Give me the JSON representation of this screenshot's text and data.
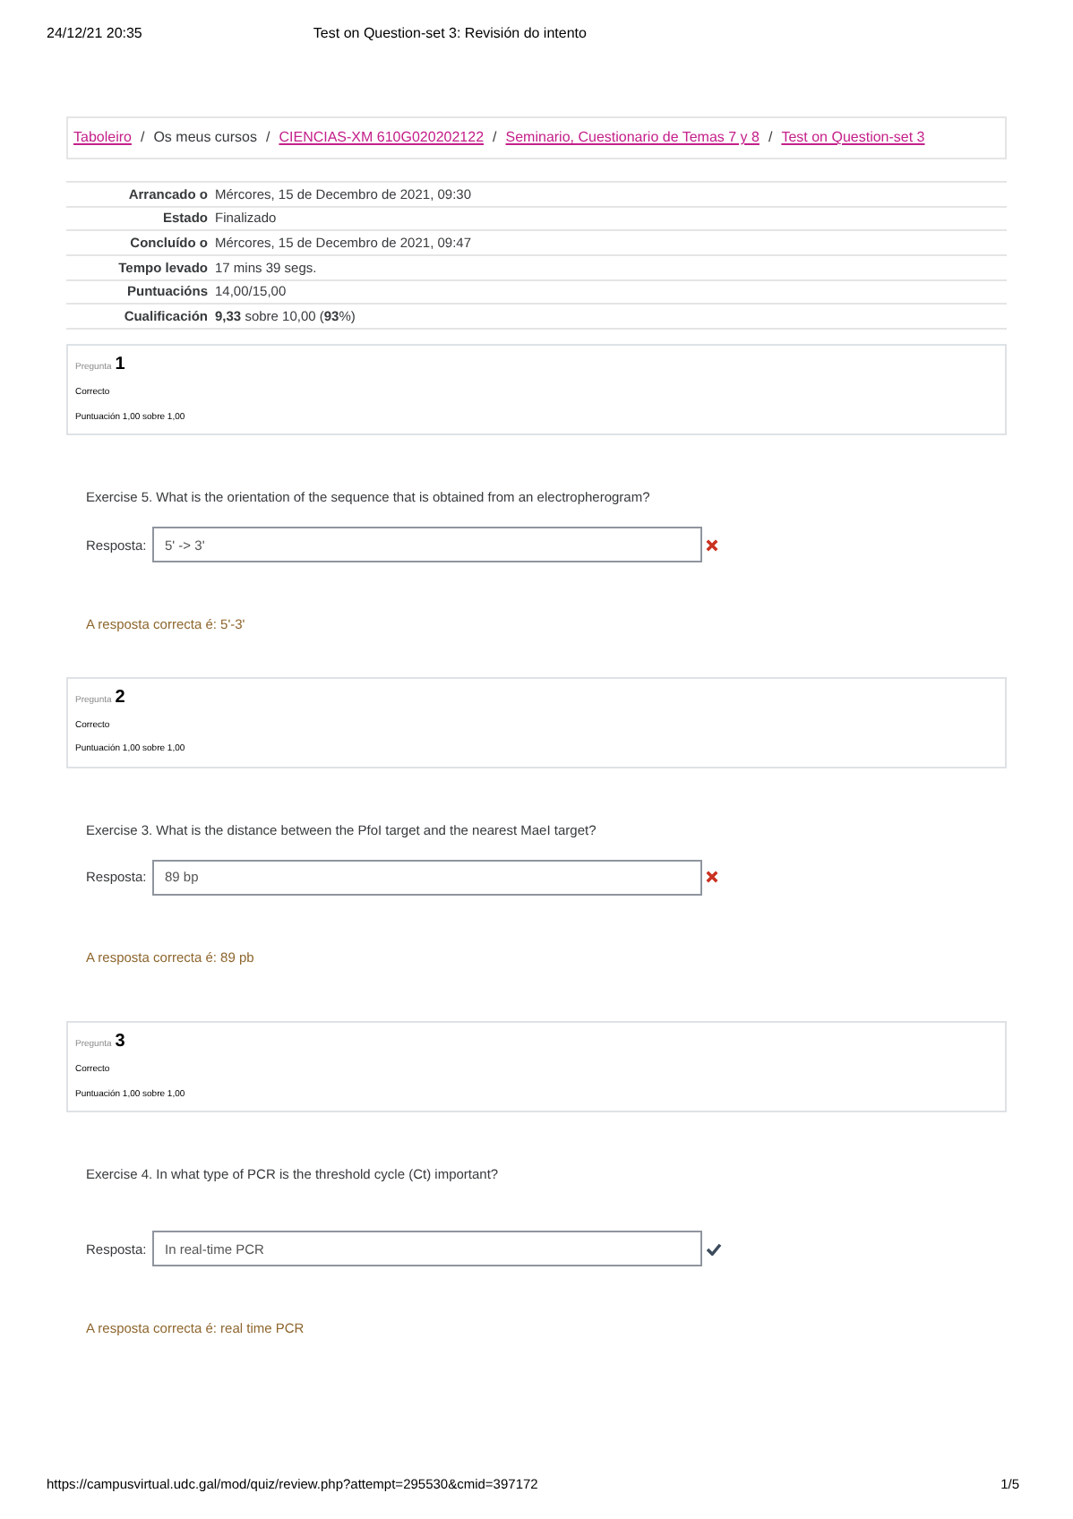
{
  "print_header": {
    "date": "24/12/21 20:35",
    "title": "Test on Question-set 3: Revisión do intento"
  },
  "breadcrumb": [
    {
      "label": "Taboleiro",
      "link": true
    },
    {
      "separator": "/",
      "label": "Os meus cursos",
      "link": false
    },
    {
      "separator": "/",
      "label": "CIENCIAS-XM 610G020202122",
      "link": true
    },
    {
      "separator": "/",
      "label": "Seminario, Cuestionario de Temas 7 y 8",
      "link": true
    },
    {
      "separator": "/",
      "label": "Test on Question-set 3",
      "link": true
    }
  ],
  "summary": [
    {
      "label": "Arrancado o",
      "value": "Mércores, 15 de Decembro de 2021, 09:30"
    },
    {
      "label": "Estado",
      "value": "Finalizado"
    },
    {
      "label": "Concluído o",
      "value": "Mércores, 15 de Decembro de 2021, 09:47"
    },
    {
      "label": "Tempo levado",
      "value": "17 mins 39 segs."
    },
    {
      "label": "Puntuacións",
      "value": "14,00/15,00"
    },
    {
      "label": "Cualificación",
      "value": "**9,33** sobre 10,00 (**93**%)"
    }
  ],
  "questions": [
    {
      "prefix": "Pregunta",
      "number": "1",
      "state": "Correcto",
      "score": "Puntuación 1,00 sobre 1,00",
      "text": "Exercise 5. What is the orientation of the sequence that is obtained from an electropherogram?",
      "answer_label": "Resposta:",
      "answer": "5' -> 3'",
      "correct": false,
      "right_answer": "A resposta correcta é: 5'-3'"
    },
    {
      "prefix": "Pregunta",
      "number": "2",
      "state": "Correcto",
      "score": "Puntuación 1,00 sobre 1,00",
      "text": "Exercise 3. What is the distance between the PfoI target and the nearest MaeI target?",
      "answer_label": "Resposta:",
      "answer": "89 bp",
      "correct": false,
      "right_answer": "A resposta correcta é: 89 pb"
    },
    {
      "prefix": "Pregunta",
      "number": "3",
      "state": "Correcto",
      "score": "Puntuación 1,00 sobre 1,00",
      "text": "Exercise 4. In what type of PCR is the threshold cycle (Ct) important?",
      "answer_label": "Resposta:",
      "answer": "In real-time PCR",
      "correct": true,
      "right_answer": "A resposta correcta é: real time PCR"
    }
  ],
  "print_footer": {
    "url": "https://campusvirtual.udc.gal/mod/quiz/review.php?attempt=295530&cmid=397172",
    "page": "1/5"
  }
}
